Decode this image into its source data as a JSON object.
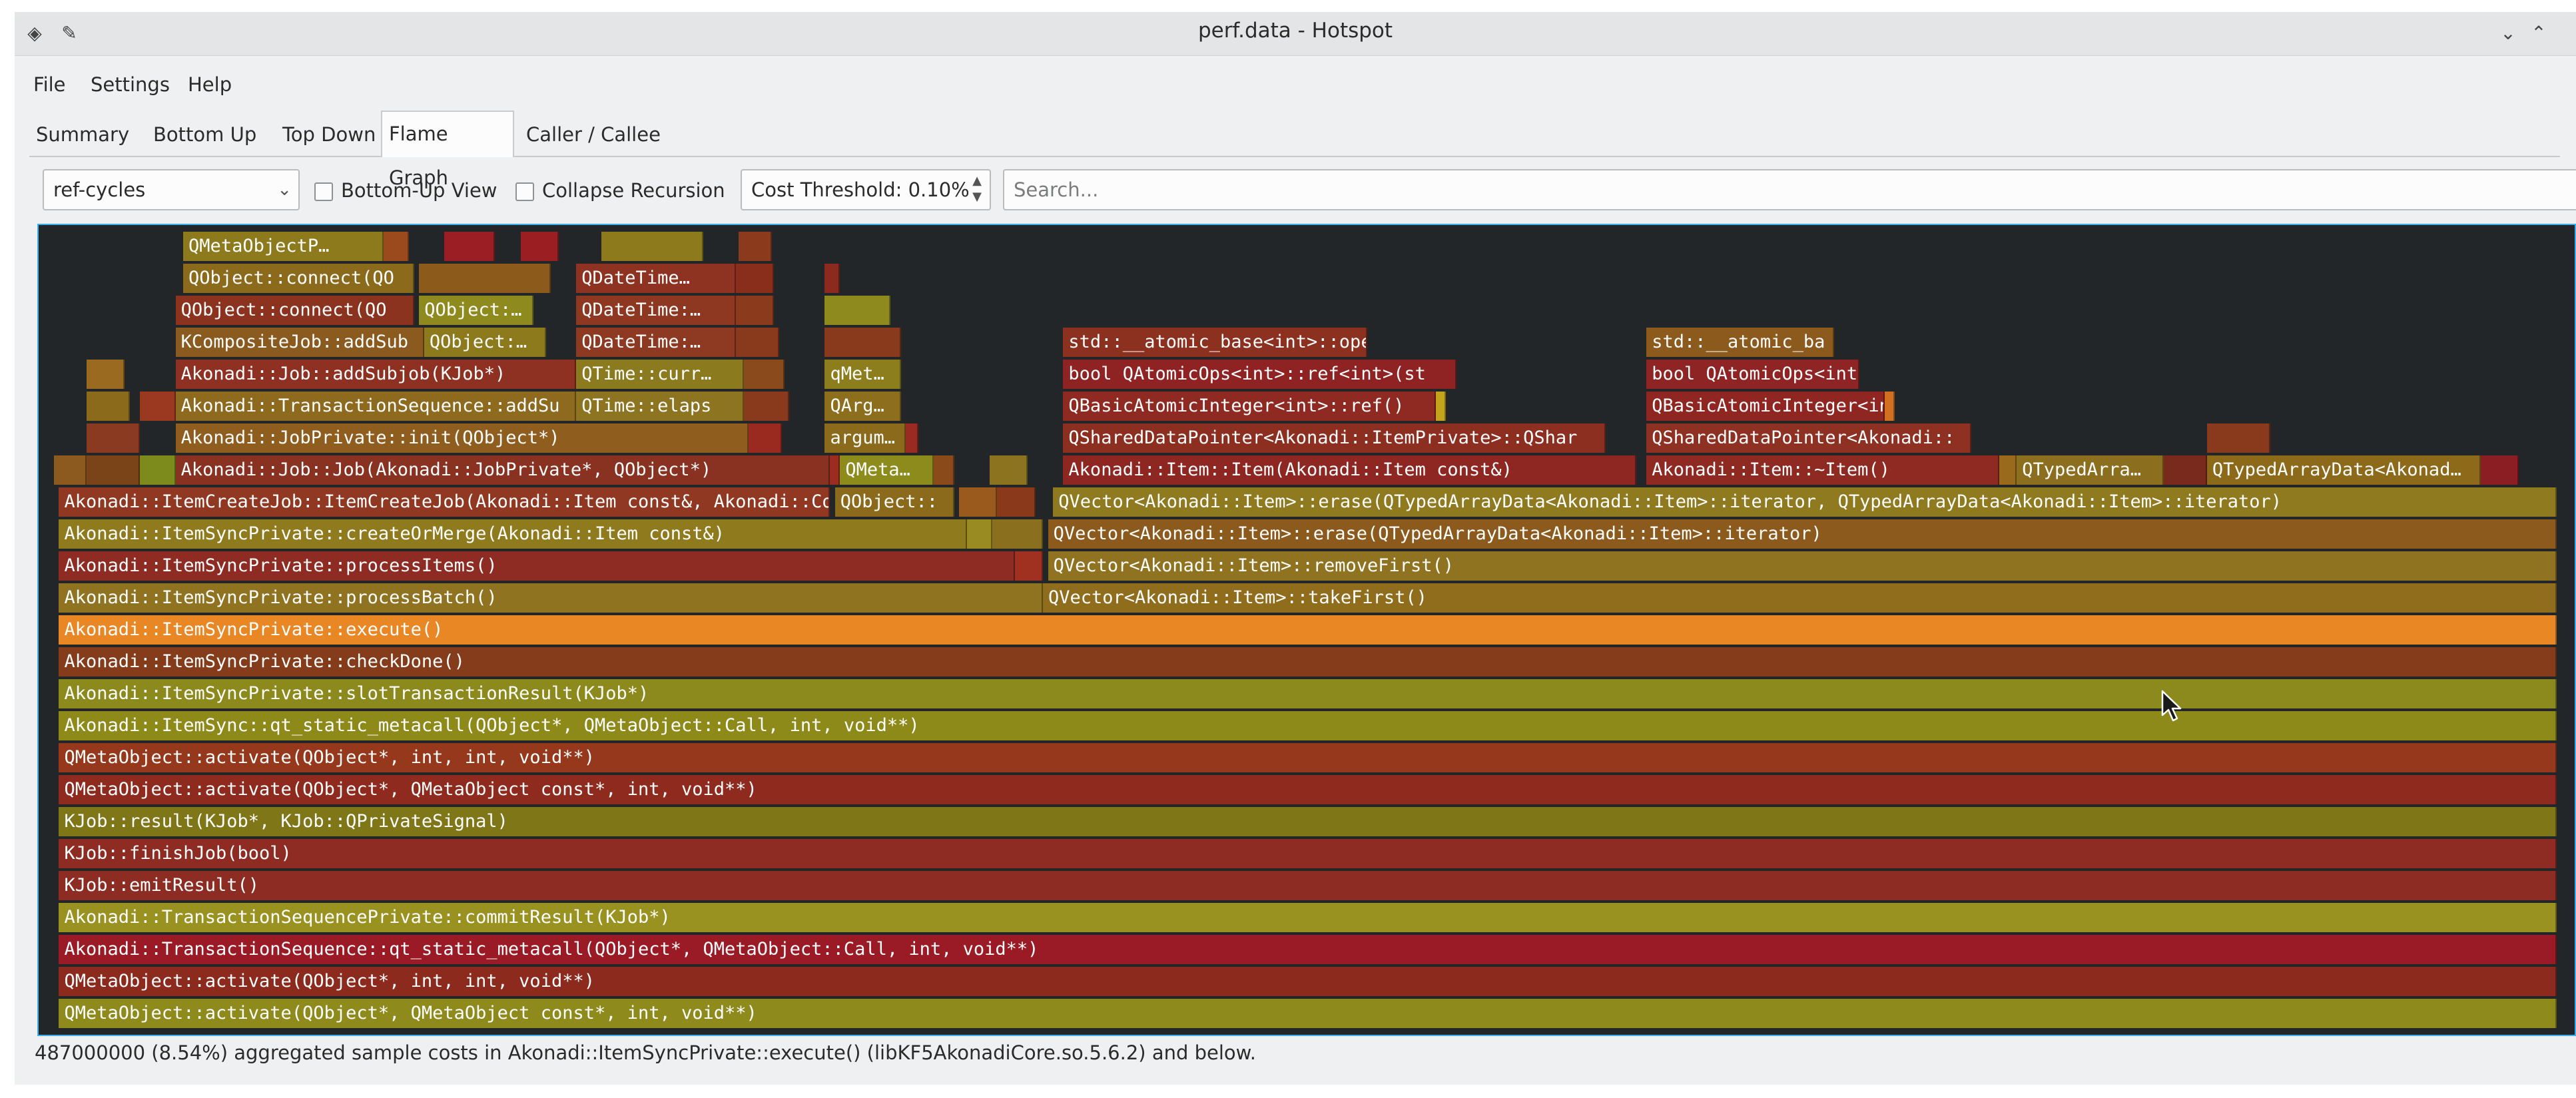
{
  "window": {
    "title": "perf.data - Hotspot"
  },
  "menu": {
    "items": [
      "File",
      "Settings",
      "Help"
    ]
  },
  "tabs": [
    {
      "label": "Summary"
    },
    {
      "label": "Bottom Up"
    },
    {
      "label": "Top Down"
    },
    {
      "label": "Flame Graph",
      "active": true
    },
    {
      "label": "Caller / Callee"
    }
  ],
  "toolbar": {
    "event_type": "ref-cycles",
    "bottom_up_label": "Bottom-Up View",
    "collapse_label": "Collapse Recursion",
    "threshold_label": "Cost Threshold: 0.10%",
    "search_placeholder": "Search..."
  },
  "flame": {
    "colors": {
      "background": "#232629",
      "selection_border": "#3daee9"
    },
    "frames": [
      {
        "row": 0,
        "start": 0.008,
        "end": 0.993,
        "label": "QMetaObject::activate(QObject*, QMetaObject const*, int, void**)",
        "color": "#8f8a1c"
      },
      {
        "row": 1,
        "start": 0.008,
        "end": 0.993,
        "label": "QMetaObject::activate(QObject*, int, int, void**)",
        "color": "#8c2a1e"
      },
      {
        "row": 2,
        "start": 0.008,
        "end": 0.993,
        "label": "Akonadi::TransactionSequence::qt_static_metacall(QObject*, QMetaObject::Call, int, void**)",
        "color": "#9a1b25"
      },
      {
        "row": 3,
        "start": 0.008,
        "end": 0.993,
        "label": "Akonadi::TransactionSequencePrivate::commitResult(KJob*)",
        "color": "#9a9220"
      },
      {
        "row": 4,
        "start": 0.008,
        "end": 0.993,
        "label": "KJob::emitResult()",
        "color": "#8c2c22"
      },
      {
        "row": 5,
        "start": 0.008,
        "end": 0.993,
        "label": "KJob::finishJob(bool)",
        "color": "#8e2b22"
      },
      {
        "row": 6,
        "start": 0.008,
        "end": 0.993,
        "label": "KJob::result(KJob*, KJob::QPrivateSignal)",
        "color": "#7f7618"
      },
      {
        "row": 7,
        "start": 0.008,
        "end": 0.993,
        "label": "QMetaObject::activate(QObject*, QMetaObject const*, int, void**)",
        "color": "#8e2b1e"
      },
      {
        "row": 8,
        "start": 0.008,
        "end": 0.993,
        "label": "QMetaObject::activate(QObject*, int, int, void**)",
        "color": "#96381b"
      },
      {
        "row": 9,
        "start": 0.008,
        "end": 0.993,
        "label": "Akonadi::ItemSync::qt_static_metacall(QObject*, QMetaObject::Call, int, void**)",
        "color": "#8d8a1a"
      },
      {
        "row": 10,
        "start": 0.008,
        "end": 0.993,
        "label": "Akonadi::ItemSyncPrivate::slotTransactionResult(KJob*)",
        "color": "#8c8a1c"
      },
      {
        "row": 11,
        "start": 0.008,
        "end": 0.993,
        "label": "Akonadi::ItemSyncPrivate::checkDone()",
        "color": "#843c1b"
      },
      {
        "row": 12,
        "start": 0.008,
        "end": 0.993,
        "label": "Akonadi::ItemSyncPrivate::execute()",
        "color": "#e98725"
      },
      {
        "row": 13,
        "start": 0.008,
        "end": 0.396,
        "label": "Akonadi::ItemSyncPrivate::processBatch()",
        "color": "#8f7320"
      },
      {
        "row": 13,
        "start": 0.396,
        "end": 0.993,
        "label": "QVector<Akonadi::Item>::takeFirst()",
        "color": "#8f6d1d"
      },
      {
        "row": 14,
        "start": 0.008,
        "end": 0.385,
        "label": "Akonadi::ItemSyncPrivate::processItems()",
        "color": "#8e2b22"
      },
      {
        "row": 14,
        "start": 0.385,
        "end": 0.396,
        "label": "",
        "color": "#a0301f"
      },
      {
        "row": 14,
        "start": 0.398,
        "end": 0.993,
        "label": "QVector<Akonadi::Item>::removeFirst()",
        "color": "#8f7320"
      },
      {
        "row": 15,
        "start": 0.008,
        "end": 0.366,
        "label": "Akonadi::ItemSyncPrivate::createOrMerge(Akonadi::Item const&)",
        "color": "#8f7b1d"
      },
      {
        "row": 15,
        "start": 0.366,
        "end": 0.376,
        "label": "",
        "color": "#9a8a22"
      },
      {
        "row": 15,
        "start": 0.376,
        "end": 0.396,
        "label": "",
        "color": "#8a6f1e"
      },
      {
        "row": 15,
        "start": 0.398,
        "end": 0.993,
        "label": "QVector<Akonadi::Item>::erase(QTypedArrayData<Akonadi::Item>::iterator)",
        "color": "#8c5a1c"
      },
      {
        "row": 16,
        "start": 0.008,
        "end": 0.312,
        "label": "Akonadi::ItemCreateJob::ItemCreateJob(Akonadi::Item const&, Akonadi::Collection const&, QObject*)",
        "color": "#903822"
      },
      {
        "row": 16,
        "start": 0.314,
        "end": 0.361,
        "label": "QObject::",
        "color": "#8c6a1c"
      },
      {
        "row": 16,
        "start": 0.363,
        "end": 0.378,
        "label": "",
        "color": "#9a5a1e"
      },
      {
        "row": 16,
        "start": 0.378,
        "end": 0.393,
        "label": "",
        "color": "#8a3a1a"
      },
      {
        "row": 16,
        "start": 0.4,
        "end": 0.993,
        "label": "QVector<Akonadi::Item>::erase(QTypedArrayData<Akonadi::Item>::iterator, QTypedArrayData<Akonadi::Item>::iterator)",
        "color": "#8f7a1f"
      },
      {
        "row": 17,
        "start": 0.006,
        "end": 0.019,
        "label": "",
        "color": "#8c5a1e"
      },
      {
        "row": 17,
        "start": 0.019,
        "end": 0.04,
        "label": "",
        "color": "#7a4418"
      },
      {
        "row": 17,
        "start": 0.04,
        "end": 0.054,
        "label": "",
        "color": "#7d8a1c"
      },
      {
        "row": 17,
        "start": 0.054,
        "end": 0.312,
        "label": "Akonadi::Job::Job(Akonadi::JobPrivate*, QObject*)",
        "color": "#8a3222"
      },
      {
        "row": 17,
        "start": 0.312,
        "end": 0.316,
        "label": "",
        "color": "#9a2c20"
      },
      {
        "row": 17,
        "start": 0.316,
        "end": 0.353,
        "label": "QMeta…",
        "color": "#8e8b1d"
      },
      {
        "row": 17,
        "start": 0.353,
        "end": 0.361,
        "label": "",
        "color": "#8a4a1a"
      },
      {
        "row": 17,
        "start": 0.375,
        "end": 0.39,
        "label": "",
        "color": "#8c7320"
      },
      {
        "row": 17,
        "start": 0.404,
        "end": 0.63,
        "label": "Akonadi::Item::Item(Akonadi::Item const&)",
        "color": "#8e2622"
      },
      {
        "row": 17,
        "start": 0.634,
        "end": 0.773,
        "label": "Akonadi::Item::~Item()",
        "color": "#8f2a22"
      },
      {
        "row": 17,
        "start": 0.773,
        "end": 0.78,
        "label": "",
        "color": "#9a6a1c"
      },
      {
        "row": 17,
        "start": 0.78,
        "end": 0.838,
        "label": "QTypedArra…",
        "color": "#8c6f1e"
      },
      {
        "row": 17,
        "start": 0.838,
        "end": 0.855,
        "label": "",
        "color": "#7a2a1c"
      },
      {
        "row": 17,
        "start": 0.855,
        "end": 0.963,
        "label": "QTypedArrayData<Akonad…",
        "color": "#8c6a1a"
      },
      {
        "row": 17,
        "start": 0.963,
        "end": 0.978,
        "label": "",
        "color": "#8a1e22"
      },
      {
        "row": 18,
        "start": 0.019,
        "end": 0.04,
        "label": "",
        "color": "#8a3a20"
      },
      {
        "row": 18,
        "start": 0.054,
        "end": 0.28,
        "label": "Akonadi::JobPrivate::init(QObject*)",
        "color": "#8f5e1f"
      },
      {
        "row": 18,
        "start": 0.28,
        "end": 0.293,
        "label": "",
        "color": "#9a2a20"
      },
      {
        "row": 18,
        "start": 0.31,
        "end": 0.342,
        "label": "argum…",
        "color": "#8c6a1c"
      },
      {
        "row": 18,
        "start": 0.342,
        "end": 0.347,
        "label": "",
        "color": "#9a2a22"
      },
      {
        "row": 18,
        "start": 0.404,
        "end": 0.618,
        "label": "QSharedDataPointer<Akonadi::ItemPrivate>::QShar",
        "color": "#8c2e20"
      },
      {
        "row": 18,
        "start": 0.634,
        "end": 0.762,
        "label": "QSharedDataPointer<Akonadi::",
        "color": "#8e3022"
      },
      {
        "row": 18,
        "start": 0.855,
        "end": 0.88,
        "label": "",
        "color": "#8a3a1c"
      },
      {
        "row": 19,
        "start": 0.019,
        "end": 0.036,
        "label": "",
        "color": "#8c6a1c"
      },
      {
        "row": 19,
        "start": 0.04,
        "end": 0.054,
        "label": "",
        "color": "#9a3820"
      },
      {
        "row": 19,
        "start": 0.054,
        "end": 0.212,
        "label": "Akonadi::TransactionSequence::addSu",
        "color": "#8d6a1e"
      },
      {
        "row": 19,
        "start": 0.212,
        "end": 0.278,
        "label": "QTime::elaps",
        "color": "#8c7420"
      },
      {
        "row": 19,
        "start": 0.278,
        "end": 0.296,
        "label": "",
        "color": "#8a3a1c"
      },
      {
        "row": 19,
        "start": 0.31,
        "end": 0.34,
        "label": "QArg…",
        "color": "#8c6e1c"
      },
      {
        "row": 19,
        "start": 0.404,
        "end": 0.551,
        "label": "QBasicAtomicInteger<int>::ref()",
        "color": "#8e2a22"
      },
      {
        "row": 19,
        "start": 0.551,
        "end": 0.555,
        "label": "",
        "color": "#c4a41c"
      },
      {
        "row": 19,
        "start": 0.634,
        "end": 0.728,
        "label": "QBasicAtomicInteger<int>",
        "color": "#902622"
      },
      {
        "row": 19,
        "start": 0.728,
        "end": 0.732,
        "label": "",
        "color": "#d07020"
      },
      {
        "row": 20,
        "start": 0.019,
        "end": 0.034,
        "label": "",
        "color": "#9a6a20"
      },
      {
        "row": 20,
        "start": 0.054,
        "end": 0.212,
        "label": "Akonadi::Job::addSubjob(KJob*)",
        "color": "#8e3022"
      },
      {
        "row": 20,
        "start": 0.212,
        "end": 0.278,
        "label": "QTime::curr…",
        "color": "#8c7a1e"
      },
      {
        "row": 20,
        "start": 0.278,
        "end": 0.294,
        "label": "",
        "color": "#8a4a1c"
      },
      {
        "row": 20,
        "start": 0.31,
        "end": 0.34,
        "label": "qMet…",
        "color": "#8c7e1d"
      },
      {
        "row": 20,
        "start": 0.404,
        "end": 0.559,
        "label": "bool QAtomicOps<int>::ref<int>(st",
        "color": "#8f2222"
      },
      {
        "row": 20,
        "start": 0.634,
        "end": 0.718,
        "label": "bool QAtomicOps<int>::",
        "color": "#8f2424"
      },
      {
        "row": 21,
        "start": 0.054,
        "end": 0.152,
        "label": "KCompositeJob::addSub",
        "color": "#8a5a1e"
      },
      {
        "row": 21,
        "start": 0.152,
        "end": 0.2,
        "label": "QObject:…",
        "color": "#8c7a1d"
      },
      {
        "row": 21,
        "start": 0.212,
        "end": 0.275,
        "label": "QDateTime:…",
        "color": "#8e3a22"
      },
      {
        "row": 21,
        "start": 0.275,
        "end": 0.292,
        "label": "",
        "color": "#8a3a1c"
      },
      {
        "row": 21,
        "start": 0.31,
        "end": 0.34,
        "label": "",
        "color": "#8a3a1c"
      },
      {
        "row": 21,
        "start": 0.404,
        "end": 0.524,
        "label": "std::__atomic_base<int>::opera",
        "color": "#8c3020"
      },
      {
        "row": 21,
        "start": 0.634,
        "end": 0.708,
        "label": "std::__atomic_ba",
        "color": "#8c5a1c"
      },
      {
        "row": 22,
        "start": 0.054,
        "end": 0.148,
        "label": "QObject::connect(QO",
        "color": "#8c3320"
      },
      {
        "row": 22,
        "start": 0.15,
        "end": 0.195,
        "label": "QObject:…",
        "color": "#8f8a1e"
      },
      {
        "row": 22,
        "start": 0.212,
        "end": 0.275,
        "label": "QDateTime:…",
        "color": "#8e3822"
      },
      {
        "row": 22,
        "start": 0.275,
        "end": 0.29,
        "label": "",
        "color": "#8c3a1c"
      },
      {
        "row": 22,
        "start": 0.31,
        "end": 0.336,
        "label": "",
        "color": "#8f8a1e"
      },
      {
        "row": 23,
        "start": 0.057,
        "end": 0.148,
        "label": "QObject::connect(QO",
        "color": "#8c6a1c"
      },
      {
        "row": 23,
        "start": 0.15,
        "end": 0.202,
        "label": "",
        "color": "#8c5a1a"
      },
      {
        "row": 23,
        "start": 0.212,
        "end": 0.275,
        "label": "QDateTime…",
        "color": "#8e3222"
      },
      {
        "row": 23,
        "start": 0.275,
        "end": 0.29,
        "label": "",
        "color": "#8a2e1c"
      },
      {
        "row": 23,
        "start": 0.31,
        "end": 0.316,
        "label": "",
        "color": "#8c2a20"
      },
      {
        "row": 24,
        "start": 0.057,
        "end": 0.136,
        "label": "QMetaObjectP…",
        "color": "#8c7a1d"
      },
      {
        "row": 24,
        "start": 0.136,
        "end": 0.146,
        "label": "",
        "color": "#9a4a1c"
      },
      {
        "row": 24,
        "start": 0.16,
        "end": 0.18,
        "label": "",
        "color": "#9a1e24"
      },
      {
        "row": 24,
        "start": 0.19,
        "end": 0.205,
        "label": "",
        "color": "#9a1e22"
      },
      {
        "row": 24,
        "start": 0.222,
        "end": 0.262,
        "label": "",
        "color": "#8c7a1c"
      },
      {
        "row": 24,
        "start": 0.276,
        "end": 0.289,
        "label": "",
        "color": "#8c3a1c"
      }
    ]
  },
  "status": {
    "text": "487000000 (8.54%) aggregated sample costs in Akonadi::ItemSyncPrivate::execute() (libKF5AkonadiCore.so.5.6.2) and below."
  }
}
